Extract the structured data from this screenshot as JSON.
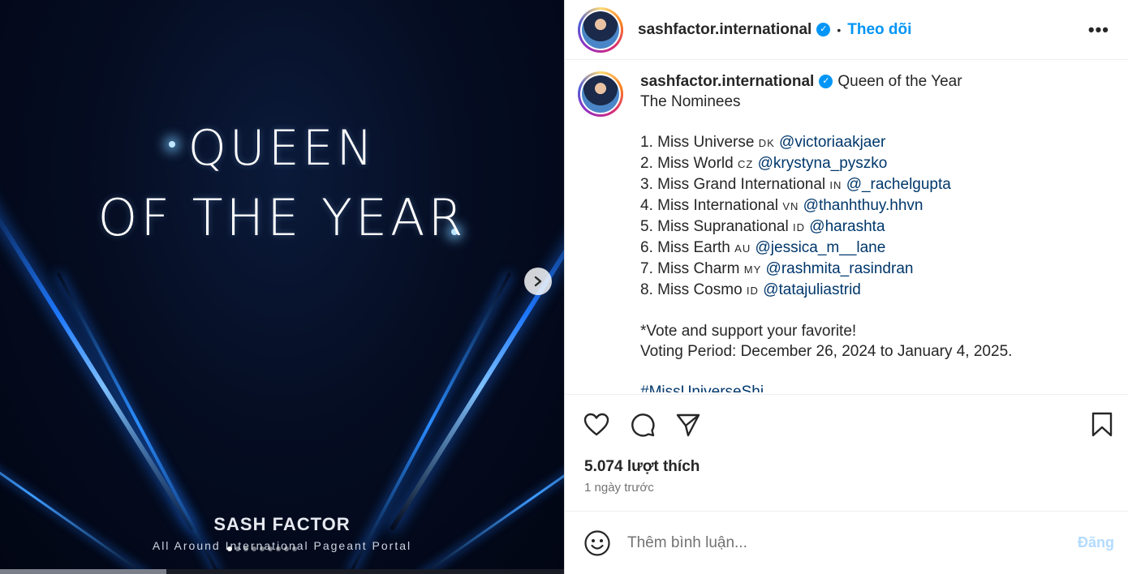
{
  "media": {
    "title_line1": "QUEEN",
    "title_line2": "OF THE YEAR",
    "brand": "SASH FACTOR",
    "brand_sub": "All Around International Pageant Portal",
    "next_icon": "chevron-right-icon",
    "dots_count": 9,
    "active_dot": 0
  },
  "header": {
    "username": "sashfactor.international",
    "separator": "•",
    "follow_label": "Theo dõi",
    "more_label": "•••"
  },
  "caption": {
    "username": "sashfactor.international",
    "title": "Queen of the Year",
    "subtitle": "The Nominees",
    "nominees": [
      {
        "label": "1. Miss Universe",
        "flag": "DK",
        "mention": "@victoriaakjaer"
      },
      {
        "label": "2. Miss World",
        "flag": "CZ",
        "mention": "@krystyna_pyszko"
      },
      {
        "label": "3. Miss Grand International",
        "flag": "IN",
        "mention": "@_rachelgupta"
      },
      {
        "label": "4. Miss International",
        "flag": "VN",
        "mention": "@thanhthuy.hhvn"
      },
      {
        "label": "5. Miss Supranational",
        "flag": "ID",
        "mention": "@harashta"
      },
      {
        "label": "6. Miss Earth",
        "flag": "AU",
        "mention": "@jessica_m__lane"
      },
      {
        "label": "7. Miss Charm",
        "flag": "MY",
        "mention": "@rashmita_rasindran"
      },
      {
        "label": "8. Miss Cosmo",
        "flag": "ID",
        "mention": "@tatajuliastrid"
      }
    ],
    "vote_line": "*Vote and support your favorite!",
    "period_line": "Voting Period: December 26, 2024 to January 4, 2025.",
    "hashtag_partial": "#MissUniverseShi..."
  },
  "actions": {
    "like_icon": "heart-icon",
    "comment_icon": "comment-icon",
    "share_icon": "send-icon",
    "save_icon": "bookmark-icon",
    "likes": "5.074 lượt thích",
    "time": "1 ngày trước"
  },
  "comment": {
    "emoji_icon": "smiley-icon",
    "placeholder": "Thêm bình luận...",
    "post_label": "Đăng"
  },
  "colors": {
    "accent": "#0095f6",
    "mention": "#00376b",
    "muted": "#737373",
    "post_disabled": "#b3dbff"
  }
}
